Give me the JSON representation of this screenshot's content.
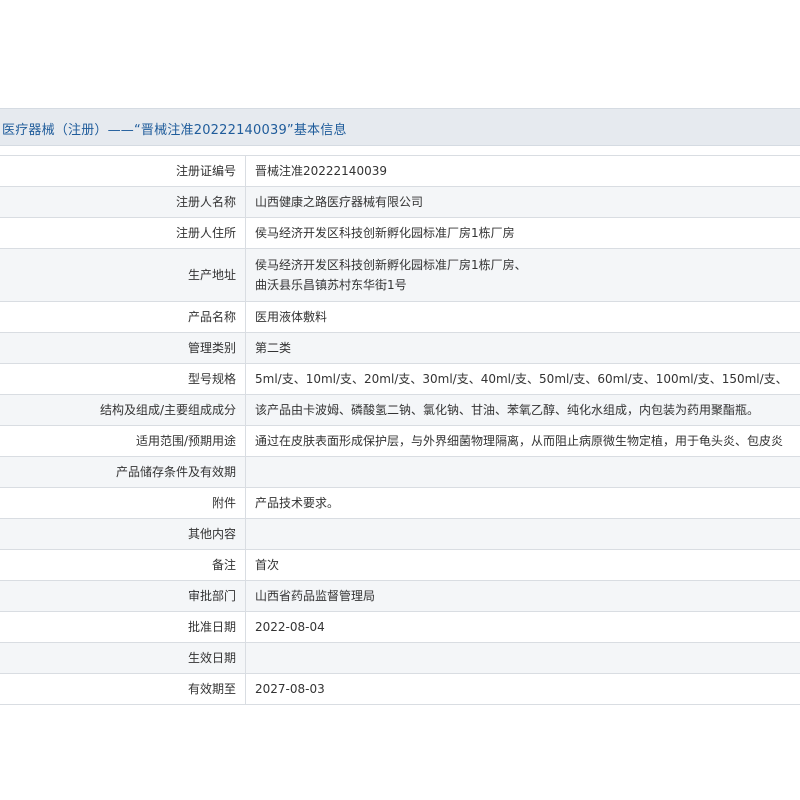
{
  "header": {
    "title": "医疗器械（注册）——“晋械注准20222140039”基本信息"
  },
  "rows": [
    {
      "label": "注册证编号",
      "value": "晋械注准20222140039"
    },
    {
      "label": "注册人名称",
      "value": "山西健康之路医疗器械有限公司"
    },
    {
      "label": "注册人住所",
      "value": "侯马经济开发区科技创新孵化园标准厂房1栋厂房"
    },
    {
      "label": "生产地址",
      "value_line1": "侯马经济开发区科技创新孵化园标准厂房1栋厂房、",
      "value_line2": "曲沃县乐昌镇苏村东华街1号"
    },
    {
      "label": "产品名称",
      "value": "医用液体敷料"
    },
    {
      "label": "管理类别",
      "value": "第二类"
    },
    {
      "label": "型号规格",
      "value": "5ml/支、10ml/支、20ml/支、30ml/支、40ml/支、50ml/支、60ml/支、100ml/支、150ml/支、"
    },
    {
      "label": "结构及组成/主要组成成分",
      "value": "该产品由卡波姆、磷酸氢二钠、氯化钠、甘油、苯氧乙醇、纯化水组成，内包装为药用聚酯瓶。"
    },
    {
      "label": "适用范围/预期用途",
      "value": "通过在皮肤表面形成保护层，与外界细菌物理隔离，从而阻止病原微生物定植，用于龟头炎、包皮炎"
    },
    {
      "label": "产品储存条件及有效期",
      "value": ""
    },
    {
      "label": "附件",
      "value": "产品技术要求。"
    },
    {
      "label": "其他内容",
      "value": ""
    },
    {
      "label": "备注",
      "value": "首次"
    },
    {
      "label": "审批部门",
      "value": "山西省药品监督管理局"
    },
    {
      "label": "批准日期",
      "value": "2022-08-04"
    },
    {
      "label": "生效日期",
      "value": ""
    },
    {
      "label": "有效期至",
      "value": "2027-08-03"
    }
  ]
}
